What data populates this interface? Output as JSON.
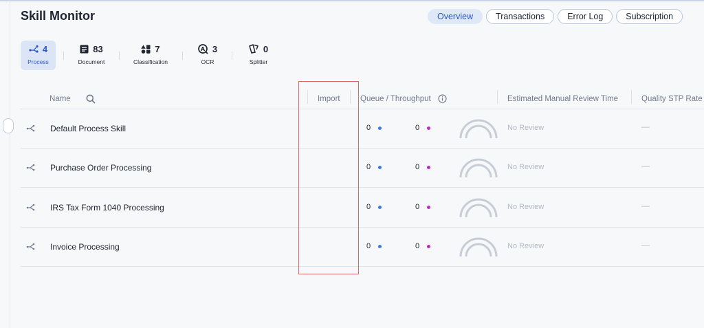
{
  "title": "Skill Monitor",
  "tabs": [
    {
      "label": "Overview",
      "active": true
    },
    {
      "label": "Transactions",
      "active": false
    },
    {
      "label": "Error Log",
      "active": false
    },
    {
      "label": "Subscription",
      "active": false
    }
  ],
  "categories": [
    {
      "label": "Process",
      "count": "4",
      "icon": "process-icon",
      "active": true
    },
    {
      "label": "Document",
      "count": "83",
      "icon": "document-icon",
      "active": false
    },
    {
      "label": "Classification",
      "count": "7",
      "icon": "classification-icon",
      "active": false
    },
    {
      "label": "OCR",
      "count": "3",
      "icon": "ocr-icon",
      "active": false
    },
    {
      "label": "Splitter",
      "count": "0",
      "icon": "splitter-icon",
      "active": false
    }
  ],
  "table": {
    "headers": {
      "name": "Name",
      "import": "Import",
      "queue": "Queue / Throughput",
      "review_time": "Estimated Manual Review Time",
      "quality": "Quality STP Rate"
    },
    "rows": [
      {
        "name": "Default Process Skill",
        "queue": "0",
        "throughput": "0",
        "review": "No Review",
        "quality": "—"
      },
      {
        "name": "Purchase Order Processing",
        "queue": "0",
        "throughput": "0",
        "review": "No Review",
        "quality": "—"
      },
      {
        "name": "IRS Tax Form 1040 Processing",
        "queue": "0",
        "throughput": "0",
        "review": "No Review",
        "quality": "—"
      },
      {
        "name": "Invoice Processing",
        "queue": "0",
        "throughput": "0",
        "review": "No Review",
        "quality": "—"
      }
    ]
  },
  "colors": {
    "accent": "#2b59c3",
    "queue_dot": "#3b7be0",
    "throughput_dot": "#c427c9",
    "highlight_box": "#e1686a"
  }
}
